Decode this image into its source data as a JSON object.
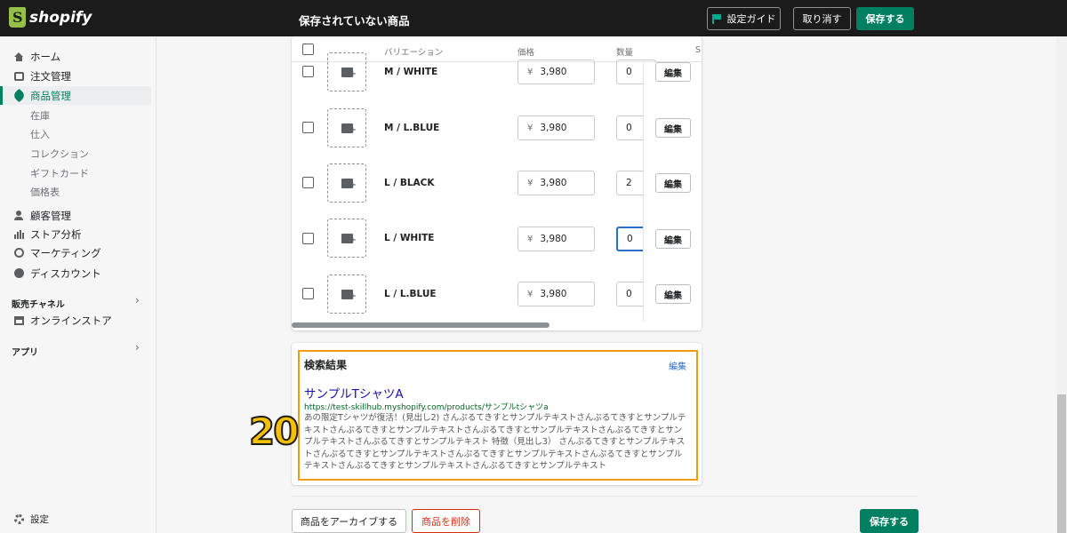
{
  "topbar": {
    "logo_text": "shopify",
    "status_text": "保存されていない商品",
    "guide_label": "設定ガイド",
    "cancel_label": "取り消す",
    "save_label": "保存する"
  },
  "sidebar": {
    "items": [
      {
        "label": "ホーム",
        "icon": "home-icon"
      },
      {
        "label": "注文管理",
        "icon": "orders-icon"
      },
      {
        "label": "商品管理",
        "icon": "tag-icon",
        "active": true
      },
      {
        "label": "顧客管理",
        "icon": "customer-icon"
      },
      {
        "label": "ストア分析",
        "icon": "analytics-icon"
      },
      {
        "label": "マーケティング",
        "icon": "marketing-icon"
      },
      {
        "label": "ディスカウント",
        "icon": "discount-icon"
      }
    ],
    "sub_items": [
      "在庫",
      "仕入",
      "コレクション",
      "ギフトカード",
      "価格表"
    ],
    "sales_channel_label": "販売チャネル",
    "online_store_label": "オンラインストア",
    "apps_label": "アプリ",
    "settings_label": "設定"
  },
  "variants": {
    "headers": {
      "variation": "バリエーション",
      "price": "価格",
      "qty": "数量",
      "sku": "S"
    },
    "currency": "¥",
    "edit_label": "編集",
    "rows": [
      {
        "name": "M / WHITE",
        "price": "3,980",
        "qty": "0"
      },
      {
        "name": "M / L.BLUE",
        "price": "3,980",
        "qty": "0"
      },
      {
        "name": "L / BLACK",
        "price": "3,980",
        "qty": "2"
      },
      {
        "name": "L / WHITE",
        "price": "3,980",
        "qty": "0"
      },
      {
        "name": "L / L.BLUE",
        "price": "3,980",
        "qty": "0"
      }
    ]
  },
  "seo": {
    "title": "検索結果",
    "edit_label": "編集",
    "link_text": "サンプルTシャツA",
    "url": "https://test-skillhub.myshopify.com/products/サンプルtシャツa",
    "description": "あの限定Tシャツが復活！(見出し2) さんぷるてきすとサンプルテキストさんぷるてきすとサンプルテキストさんぷるてきすとサンプルテキストさんぷるてきすとサンプルテキストさんぷるてきすとサンプルテキストさんぷるてきすとサンプルテキスト 特徴（見出し3） さんぷるてきすとサンプルテキストさんぷるてきすとサンプルテキストさんぷるてきすとサンプルテキストさんぷるてきすとサンプルテキストさんぷるてきすとサンプルテキストさんぷるてきすとサンプルテキスト"
  },
  "annotation": {
    "number": "20"
  },
  "footer": {
    "archive_label": "商品をアーカイブする",
    "delete_label": "商品を削除",
    "save_label": "保存する"
  },
  "colors": {
    "brand_green": "#008060",
    "highlight_orange": "#f39c12",
    "link_blue": "#1a0dab"
  }
}
